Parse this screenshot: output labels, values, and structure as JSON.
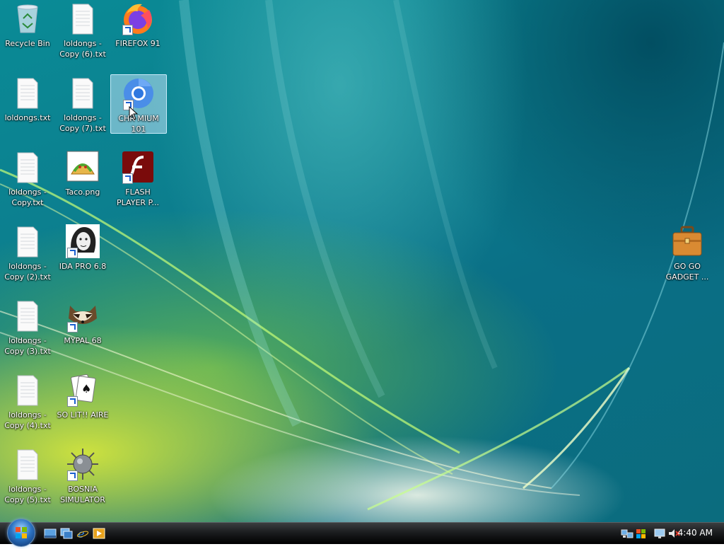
{
  "desktop": {
    "icons": [
      {
        "label": "Recycle Bin",
        "icon": "recycle-bin-icon"
      },
      {
        "label": "loldongs -\nCopy (6).txt",
        "icon": "text-file-icon"
      },
      {
        "label": "FIREFOX 91",
        "icon": "firefox-icon"
      },
      {
        "label": "loldongs.txt",
        "icon": "text-file-icon"
      },
      {
        "label": "loldongs -\nCopy (7).txt",
        "icon": "text-file-icon"
      },
      {
        "label": "CHR MIUM\n101",
        "icon": "chromium-icon"
      },
      {
        "label": "loldongs -\nCopy.txt",
        "icon": "text-file-icon"
      },
      {
        "label": "Taco.png",
        "icon": "taco-image-icon"
      },
      {
        "label": "FLASH\nPLAYER P...",
        "icon": "flash-player-icon"
      },
      {
        "label": "loldongs -\nCopy (2).txt",
        "icon": "text-file-icon"
      },
      {
        "label": "IDA PRO 6.8",
        "icon": "ida-pro-icon"
      },
      {
        "label": "loldongs -\nCopy (3).txt",
        "icon": "text-file-icon"
      },
      {
        "label": "MYPAL 68",
        "icon": "mypal-raccoon-icon"
      },
      {
        "label": "loldongs -\nCopy (4).txt",
        "icon": "text-file-icon"
      },
      {
        "label": "SO LIT!! AIRE",
        "icon": "solitaire-cards-icon"
      },
      {
        "label": "loldongs -\nCopy (5).txt",
        "icon": "text-file-icon"
      },
      {
        "label": "BOSNIA\nSIMULATOR",
        "icon": "spiked-mine-icon"
      },
      {
        "label": "GO GO\nGADGET ...",
        "icon": "briefcase-icon"
      }
    ],
    "selected": "CHR MIUM\n101"
  },
  "taskbar": {
    "start_icon": "windows-start-orb",
    "quick_launch": [
      "show-desktop-icon",
      "switch-windows-icon",
      "internet-explorer-icon",
      "media-player-icon"
    ],
    "tray_icons": [
      "network-icon",
      "volume-muted-icon"
    ],
    "clock": "4:40 AM"
  },
  "colors": {
    "wallpaper_teal": "#0a7f8e",
    "wallpaper_yellow": "#d6e63c",
    "selection": "#bee1f5",
    "taskbar": "#1b1d1f"
  }
}
